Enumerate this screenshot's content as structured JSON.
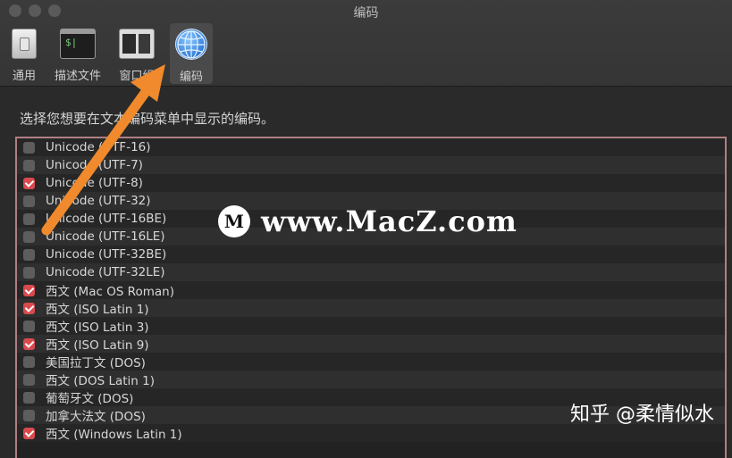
{
  "window": {
    "title": "编码"
  },
  "toolbar": {
    "items": [
      {
        "label": "通用",
        "icon": "general-switch-icon",
        "active": false
      },
      {
        "label": "描述文件",
        "icon": "terminal-profile-icon",
        "icon_text": "$|",
        "active": false
      },
      {
        "label": "窗口组",
        "icon": "window-groups-icon",
        "active": false
      },
      {
        "label": "编码",
        "icon": "globe-icon",
        "active": true
      }
    ]
  },
  "main": {
    "prompt": "选择您想要在文本编码菜单中显示的编码。",
    "encodings": [
      {
        "label": "Unicode (UTF-16)",
        "checked": false
      },
      {
        "label": "Unicode (UTF-7)",
        "checked": false
      },
      {
        "label": "Unicode (UTF-8)",
        "checked": true
      },
      {
        "label": "Unicode (UTF-32)",
        "checked": false
      },
      {
        "label": "Unicode (UTF-16BE)",
        "checked": false
      },
      {
        "label": "Unicode (UTF-16LE)",
        "checked": false
      },
      {
        "label": "Unicode (UTF-32BE)",
        "checked": false
      },
      {
        "label": "Unicode (UTF-32LE)",
        "checked": false
      },
      {
        "label": "西文 (Mac OS Roman)",
        "checked": true
      },
      {
        "label": "西文 (ISO Latin 1)",
        "checked": true
      },
      {
        "label": "西文 (ISO Latin 3)",
        "checked": false
      },
      {
        "label": "西文 (ISO Latin 9)",
        "checked": true
      },
      {
        "label": "美国拉丁文 (DOS)",
        "checked": false
      },
      {
        "label": "西文 (DOS Latin 1)",
        "checked": false
      },
      {
        "label": "葡萄牙文 (DOS)",
        "checked": false
      },
      {
        "label": "加拿大法文 (DOS)",
        "checked": false
      },
      {
        "label": "西文 (Windows Latin 1)",
        "checked": true
      }
    ]
  },
  "overlay": {
    "watermark_logo": "M",
    "watermark_text": "www.MacZ.com",
    "credit": "知乎 @柔情似水",
    "arrow_color": "#f08a2c"
  },
  "colors": {
    "checkbox_checked": "#d94a4f",
    "checkbox_unchecked": "#5d5d5d",
    "list_border": "#b07f83"
  }
}
